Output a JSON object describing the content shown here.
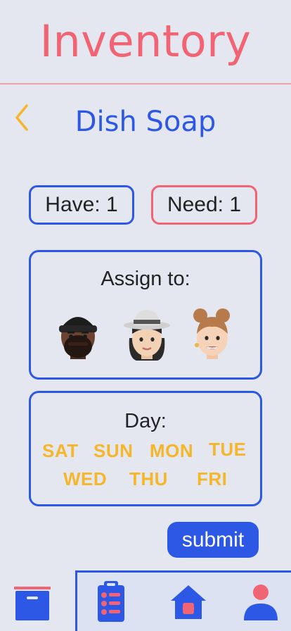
{
  "header": {
    "title": "Inventory"
  },
  "item": {
    "name": "Dish Soap",
    "have_label": "Have: 1",
    "need_label": "Need: 1"
  },
  "assign": {
    "label": "Assign to:",
    "members": [
      "memoji-man-beanie",
      "memoji-woman-hat",
      "memoji-woman-buns"
    ]
  },
  "day": {
    "label": "Day:",
    "options": [
      "SAT",
      "SUN",
      "MON",
      "TUE",
      "WED",
      "THU",
      "FRI"
    ]
  },
  "actions": {
    "submit_label": "submit"
  },
  "nav": {
    "items": [
      "box-icon",
      "list-icon",
      "home-icon",
      "profile-icon"
    ]
  },
  "colors": {
    "accent": "#2d58e6",
    "title": "#f06474",
    "day": "#f5b62a",
    "back": "#f5b62a",
    "bg": "#e4e7f0"
  }
}
